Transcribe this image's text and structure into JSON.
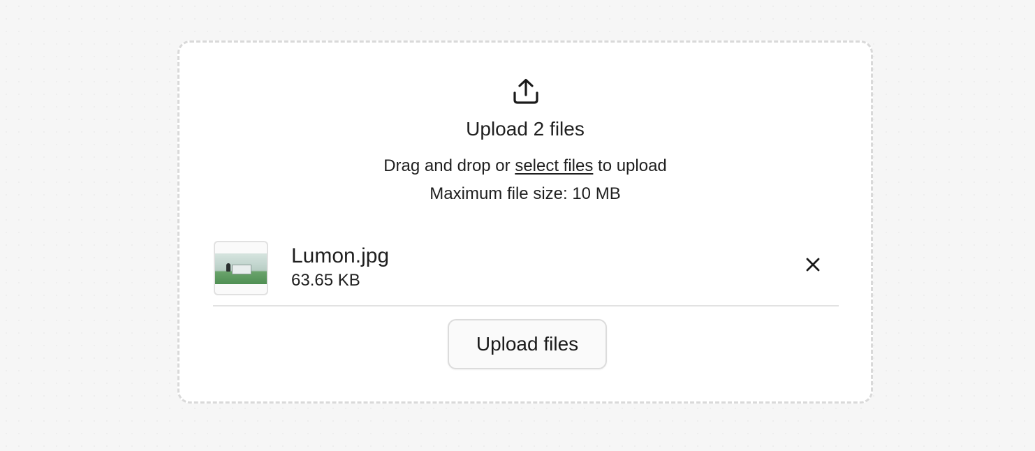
{
  "dropzone": {
    "icon": "upload-icon",
    "title": "Upload 2 files",
    "instructions_before": "Drag and drop or ",
    "select_link": "select files",
    "instructions_after": " to upload",
    "max_size": "Maximum file size: 10 MB"
  },
  "files": [
    {
      "name": "Lumon.jpg",
      "size": "63.65 KB",
      "thumbnail": "image-thumbnail",
      "remove_icon": "close-icon"
    }
  ],
  "actions": {
    "upload_label": "Upload files"
  },
  "colors": {
    "background": "#f6f6f6",
    "card": "#ffffff",
    "dashed_border": "#d9d9d9",
    "text": "#1f1f1f"
  }
}
